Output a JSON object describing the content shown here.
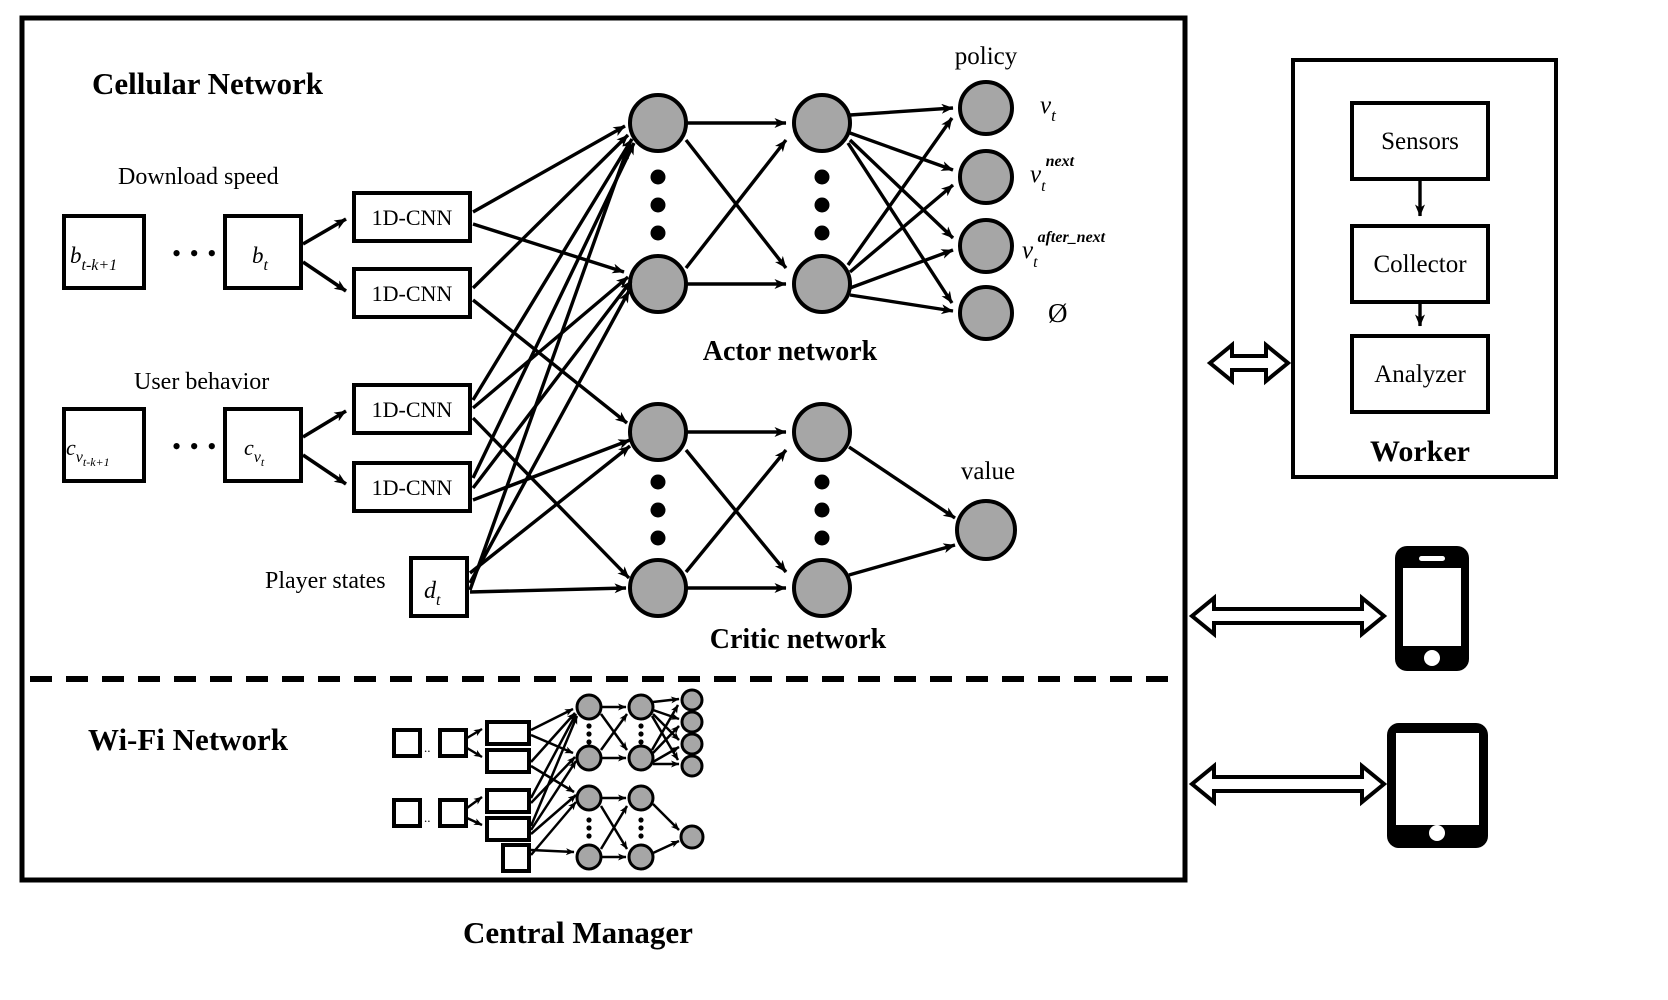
{
  "diagram": {
    "title_cellular": "Cellular Network",
    "title_wifi": "Wi-Fi Network",
    "title_central": "Central Manager",
    "title_worker": "Worker"
  },
  "inputs": {
    "download_speed_label": "Download speed",
    "download_first": "b",
    "download_first_sub": "t-k+1",
    "download_last": "b",
    "download_last_sub": "t",
    "user_behavior_label": "User behavior",
    "user_first": "c",
    "user_first_sub": "v",
    "user_first_sub2": "t-k+1",
    "user_last": "c",
    "user_last_sub": "v",
    "user_last_sub2": "t",
    "player_states_label": "Player states",
    "player_state": "d",
    "player_state_sub": "t",
    "ellipsis": "• • •"
  },
  "cnn": {
    "label": "1D-CNN",
    "count": 4
  },
  "actor": {
    "name": "Actor network",
    "policy_label": "policy",
    "outputs": [
      {
        "base": "v",
        "sub": "t",
        "sup": ""
      },
      {
        "base": "v",
        "sub": "t",
        "sup": "next"
      },
      {
        "base": "v",
        "sub": "t",
        "sup": "after_next"
      },
      {
        "base": "Ø",
        "sub": "",
        "sup": ""
      }
    ]
  },
  "critic": {
    "name": "Critic network",
    "value_label": "value"
  },
  "worker": {
    "title": "Worker",
    "stages": [
      "Sensors",
      "Collector",
      "Analyzer"
    ]
  },
  "devices": {
    "phone": "smartphone-icon",
    "tablet": "tablet-icon"
  },
  "icons": {
    "node": "neural-node",
    "vdots": "vertical-ellipsis",
    "double_arrow": "double-headed-arrow"
  },
  "colors": {
    "node_fill": "#a6a6a6",
    "stroke": "#000000",
    "background": "#ffffff"
  }
}
